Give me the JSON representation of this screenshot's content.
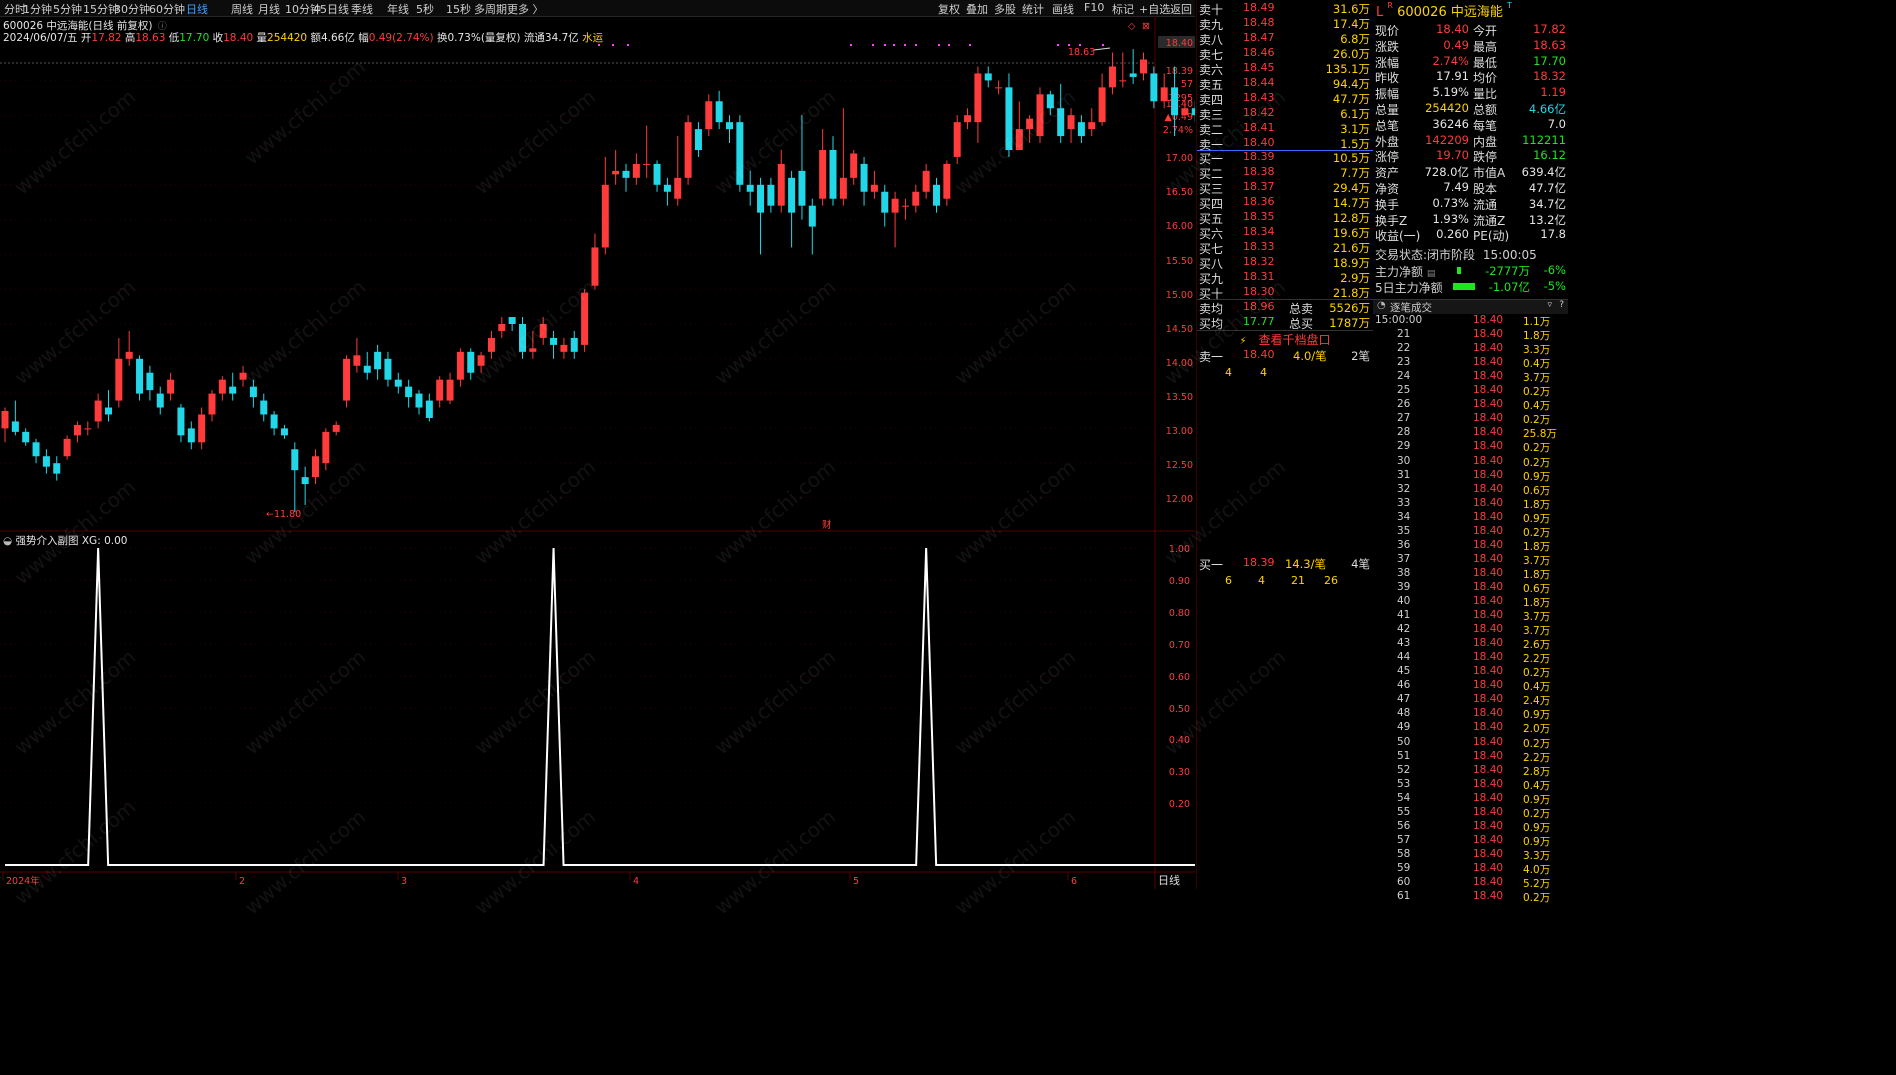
{
  "period_tabs": [
    "分时",
    "1分钟",
    "5分钟",
    "15分钟",
    "30分钟",
    "60分钟",
    "日线",
    "周线",
    "月线",
    "10分钟",
    "45日线",
    "季线",
    "年线",
    "5秒",
    "15秒",
    "多周期",
    "更多 〉"
  ],
  "active_tab": "日线",
  "right_tools": [
    "复权",
    "叠加",
    "多股",
    "统计",
    "画线",
    "F10",
    "标记",
    "+自选",
    "返回"
  ],
  "chart_title": "600026 中远海能(日线 前复权)",
  "ohlc": {
    "date": "2024/06/07/五",
    "open_lbl": "开",
    "open": "17.82",
    "high_lbl": "高",
    "high": "18.63",
    "low_lbl": "低",
    "low": "17.70",
    "close_lbl": "收",
    "close": "18.40",
    "vol_lbl": "量",
    "vol": "254420",
    "amt_lbl": "额",
    "amt": "4.66亿",
    "chg_lbl": "幅",
    "chg": "0.49(2.74%)",
    "turn": "换0.73%(量复权)",
    "float": "流通34.7亿",
    "tag": "水运"
  },
  "price_axis": [
    "18.40",
    "18.39",
    "57",
    "2295",
    "18.40",
    "▲0.49",
    "2.74%",
    "17.00",
    "16.50",
    "16.00",
    "15.50",
    "15.00",
    "14.50",
    "14.00",
    "13.50",
    "13.00",
    "12.50",
    "12.00"
  ],
  "hi_label": "18.63",
  "lo_label": "←11.80",
  "cai": "财",
  "sub_title": "强势介入副图",
  "sub_val": "XG: 0.00",
  "sub_axis": [
    "1.00",
    "0.90",
    "0.80",
    "0.70",
    "0.60",
    "0.50",
    "0.40",
    "0.30",
    "0.20"
  ],
  "date_axis": [
    "2024年",
    "2",
    "3",
    "4",
    "5",
    "6"
  ],
  "period_label": "日线",
  "candles": [
    [
      13.0,
      13.25,
      12.8,
      13.3
    ],
    [
      13.1,
      12.95,
      12.9,
      13.4
    ],
    [
      12.95,
      12.8,
      12.75,
      13.0
    ],
    [
      12.8,
      12.6,
      12.5,
      12.85
    ],
    [
      12.6,
      12.45,
      12.35,
      12.7
    ],
    [
      12.5,
      12.35,
      12.25,
      12.6
    ],
    [
      12.6,
      12.85,
      12.55,
      12.9
    ],
    [
      12.9,
      13.05,
      12.8,
      13.1
    ],
    [
      13.0,
      13.0,
      12.9,
      13.1
    ],
    [
      13.1,
      13.4,
      13.0,
      13.5
    ],
    [
      13.3,
      13.2,
      13.1,
      13.55
    ],
    [
      13.4,
      14.0,
      13.3,
      14.3
    ],
    [
      14.0,
      14.1,
      13.9,
      14.4
    ],
    [
      14.0,
      13.5,
      13.4,
      14.05
    ],
    [
      13.8,
      13.55,
      13.4,
      13.9
    ],
    [
      13.5,
      13.3,
      13.2,
      13.6
    ],
    [
      13.5,
      13.7,
      13.4,
      13.8
    ],
    [
      13.3,
      12.9,
      12.8,
      13.35
    ],
    [
      13.0,
      12.8,
      12.7,
      13.1
    ],
    [
      12.8,
      13.2,
      12.7,
      13.3
    ],
    [
      13.2,
      13.5,
      13.1,
      13.55
    ],
    [
      13.5,
      13.7,
      13.4,
      13.75
    ],
    [
      13.6,
      13.5,
      13.4,
      13.8
    ],
    [
      13.7,
      13.8,
      13.6,
      13.9
    ],
    [
      13.6,
      13.45,
      13.3,
      13.7
    ],
    [
      13.4,
      13.2,
      13.1,
      13.5
    ],
    [
      13.2,
      13.0,
      12.9,
      13.25
    ],
    [
      13.0,
      12.9,
      12.85,
      13.05
    ],
    [
      12.7,
      12.4,
      11.8,
      12.8
    ],
    [
      12.3,
      12.2,
      11.9,
      12.45
    ],
    [
      12.3,
      12.6,
      12.2,
      12.7
    ],
    [
      12.5,
      12.95,
      12.4,
      13.0
    ],
    [
      12.95,
      13.05,
      12.9,
      13.1
    ],
    [
      13.4,
      14.0,
      13.3,
      14.05
    ],
    [
      13.9,
      14.05,
      13.8,
      14.3
    ],
    [
      13.9,
      13.8,
      13.7,
      14.1
    ],
    [
      14.1,
      13.85,
      13.7,
      14.2
    ],
    [
      14.0,
      13.7,
      13.6,
      14.1
    ],
    [
      13.7,
      13.6,
      13.5,
      13.8
    ],
    [
      13.6,
      13.45,
      13.3,
      13.7
    ],
    [
      13.5,
      13.3,
      13.2,
      13.55
    ],
    [
      13.4,
      13.15,
      13.1,
      13.5
    ],
    [
      13.4,
      13.7,
      13.3,
      13.75
    ],
    [
      13.4,
      13.7,
      13.35,
      13.8
    ],
    [
      13.7,
      14.1,
      13.6,
      14.15
    ],
    [
      14.1,
      13.8,
      13.7,
      14.15
    ],
    [
      13.9,
      14.05,
      13.8,
      14.1
    ],
    [
      14.1,
      14.3,
      14.0,
      14.4
    ],
    [
      14.4,
      14.5,
      14.3,
      14.6
    ],
    [
      14.6,
      14.5,
      14.4,
      14.6
    ],
    [
      14.5,
      14.1,
      14.0,
      14.6
    ],
    [
      14.1,
      14.15,
      14.0,
      14.4
    ],
    [
      14.3,
      14.5,
      14.2,
      14.6
    ],
    [
      14.3,
      14.2,
      14.0,
      14.4
    ],
    [
      14.1,
      14.2,
      14.0,
      14.3
    ],
    [
      14.3,
      14.1,
      14.0,
      14.4
    ],
    [
      14.2,
      14.95,
      14.1,
      15.0
    ],
    [
      15.05,
      15.6,
      15.0,
      15.8
    ],
    [
      15.6,
      16.5,
      15.5,
      16.9
    ],
    [
      16.65,
      16.7,
      16.5,
      17.0
    ],
    [
      16.7,
      16.6,
      16.4,
      16.8
    ],
    [
      16.6,
      16.8,
      16.5,
      16.95
    ],
    [
      16.8,
      16.8,
      16.6,
      17.35
    ],
    [
      16.8,
      16.5,
      16.4,
      16.85
    ],
    [
      16.5,
      16.4,
      16.2,
      16.6
    ],
    [
      16.3,
      16.6,
      16.2,
      17.2
    ],
    [
      16.6,
      17.4,
      16.5,
      17.5
    ],
    [
      17.3,
      17.0,
      16.9,
      17.4
    ],
    [
      17.3,
      17.7,
      17.2,
      17.8
    ],
    [
      17.7,
      17.4,
      17.3,
      17.85
    ],
    [
      17.4,
      17.3,
      17.1,
      17.5
    ],
    [
      17.4,
      16.5,
      16.4,
      17.5
    ],
    [
      16.5,
      16.4,
      16.2,
      16.7
    ],
    [
      16.5,
      16.1,
      15.5,
      16.6
    ],
    [
      16.5,
      16.2,
      16.1,
      16.6
    ],
    [
      16.2,
      16.8,
      16.1,
      17.0
    ],
    [
      16.6,
      16.1,
      15.6,
      16.7
    ],
    [
      16.7,
      16.2,
      16.0,
      17.5
    ],
    [
      16.2,
      15.9,
      15.5,
      16.3
    ],
    [
      16.3,
      17.0,
      16.2,
      17.3
    ],
    [
      17.0,
      16.3,
      16.2,
      17.2
    ],
    [
      16.3,
      16.6,
      16.2,
      17.6
    ],
    [
      16.6,
      16.95,
      16.5,
      17.0
    ],
    [
      16.8,
      16.4,
      16.2,
      16.9
    ],
    [
      16.4,
      16.5,
      16.3,
      16.7
    ],
    [
      16.4,
      16.1,
      15.9,
      16.5
    ],
    [
      16.1,
      16.3,
      15.6,
      16.4
    ],
    [
      16.2,
      16.2,
      16.0,
      16.3
    ],
    [
      16.2,
      16.4,
      16.1,
      16.5
    ],
    [
      16.4,
      16.7,
      16.3,
      16.8
    ],
    [
      16.5,
      16.2,
      16.1,
      16.6
    ],
    [
      16.3,
      16.8,
      16.2,
      16.85
    ],
    [
      16.9,
      17.4,
      16.8,
      17.5
    ],
    [
      17.4,
      17.5,
      17.3,
      17.6
    ],
    [
      17.4,
      18.1,
      17.1,
      18.2
    ],
    [
      18.1,
      18.0,
      17.9,
      18.2
    ],
    [
      17.9,
      17.9,
      17.8,
      18.0
    ],
    [
      17.9,
      17.0,
      16.9,
      18.1
    ],
    [
      17.0,
      17.3,
      17.0,
      17.7
    ],
    [
      17.3,
      17.45,
      17.1,
      17.5
    ],
    [
      17.2,
      17.8,
      17.1,
      17.9
    ],
    [
      17.8,
      17.6,
      17.5,
      17.85
    ],
    [
      17.6,
      17.2,
      17.1,
      17.95
    ],
    [
      17.3,
      17.5,
      17.1,
      17.6
    ],
    [
      17.4,
      17.2,
      17.1,
      17.5
    ],
    [
      17.3,
      17.4,
      17.2,
      17.6
    ],
    [
      17.4,
      17.9,
      17.35,
      18.1
    ],
    [
      17.9,
      18.2,
      17.8,
      18.4
    ],
    [
      18.0,
      18.0,
      17.9,
      18.4
    ],
    [
      18.1,
      18.05,
      17.95,
      18.45
    ],
    [
      18.1,
      18.3,
      18.0,
      18.4
    ],
    [
      18.1,
      17.7,
      17.6,
      18.2
    ],
    [
      17.7,
      17.9,
      17.6,
      18.1
    ],
    [
      17.9,
      17.5,
      17.2,
      18.2
    ],
    [
      17.5,
      17.6,
      17.5,
      17.7
    ],
    [
      17.6,
      17.5,
      17.4,
      17.7
    ],
    [
      17.6,
      17.6,
      17.5,
      17.65
    ],
    [
      17.82,
      18.4,
      17.7,
      18.63
    ]
  ],
  "signal_peaks": [
    9,
    53,
    89
  ],
  "order_book": {
    "asks": [
      [
        "卖十",
        "18.49",
        "31.6万"
      ],
      [
        "卖九",
        "18.48",
        "17.4万"
      ],
      [
        "卖八",
        "18.47",
        "6.8万"
      ],
      [
        "卖七",
        "18.46",
        "26.0万"
      ],
      [
        "卖六",
        "18.45",
        "135.1万"
      ],
      [
        "卖五",
        "18.44",
        "94.4万"
      ],
      [
        "卖四",
        "18.43",
        "47.7万"
      ],
      [
        "卖三",
        "18.42",
        "6.1万"
      ],
      [
        "卖二",
        "18.41",
        "3.1万"
      ],
      [
        "卖一",
        "18.40",
        "1.5万"
      ]
    ],
    "bids": [
      [
        "买一",
        "18.39",
        "10.5万"
      ],
      [
        "买二",
        "18.38",
        "7.7万"
      ],
      [
        "买三",
        "18.37",
        "29.4万"
      ],
      [
        "买四",
        "18.36",
        "14.7万"
      ],
      [
        "买五",
        "18.35",
        "12.8万"
      ],
      [
        "买六",
        "18.34",
        "19.6万"
      ],
      [
        "买七",
        "18.33",
        "21.6万"
      ],
      [
        "买八",
        "18.32",
        "18.9万"
      ],
      [
        "买九",
        "18.31",
        "2.9万"
      ],
      [
        "买十",
        "18.30",
        "21.8万"
      ]
    ],
    "sell_avg_lbl": "卖均",
    "sell_avg": "18.96",
    "total_sell_lbl": "总卖",
    "total_sell": "5526万",
    "buy_avg_lbl": "买均",
    "buy_avg": "17.77",
    "total_buy_lbl": "总买",
    "total_buy": "1787万",
    "depth_link": "查看千档盘口",
    "ask1_lbl": "卖一",
    "ask1_px": "18.40",
    "ask1_per": "4.0/笔",
    "ask1_cnt": "2笔",
    "ask1_q": [
      "4",
      "4"
    ],
    "bid1_lbl": "买一",
    "bid1_px": "18.39",
    "bid1_per": "14.3/笔",
    "bid1_cnt": "4笔",
    "bid1_q": [
      "6",
      "4",
      "21",
      "26"
    ]
  },
  "stock_header": {
    "prefix": "L",
    "code": "600026",
    "name": "中远海能"
  },
  "stats": [
    [
      "现价",
      "18.40",
      "今开",
      "17.82"
    ],
    [
      "涨跌",
      "0.49",
      "最高",
      "18.63"
    ],
    [
      "涨幅",
      "2.74%",
      "最低",
      "17.70"
    ],
    [
      "昨收",
      "17.91",
      "均价",
      "18.32"
    ],
    [
      "振幅",
      "5.19%",
      "量比",
      "1.19"
    ],
    [
      "总量",
      "254420",
      "总额",
      "4.66亿"
    ],
    [
      "总笔",
      "36246",
      "每笔",
      "7.0"
    ],
    [
      "外盘",
      "142209",
      "内盘",
      "112211"
    ],
    [
      "涨停",
      "19.70",
      "跌停",
      "16.12"
    ],
    [
      "资产",
      "728.0亿",
      "市值A",
      "639.4亿"
    ],
    [
      "净资",
      "7.49",
      "股本",
      "47.7亿"
    ],
    [
      "换手",
      "0.73%",
      "流通",
      "34.7亿"
    ],
    [
      "换手Z",
      "1.93%",
      "流通Z",
      "13.2亿"
    ],
    [
      "收益(一)",
      "0.260",
      "PE(动)",
      "17.8"
    ]
  ],
  "trade_state_lbl": "交易状态:",
  "trade_state": "闭市阶段",
  "trade_time": "15:00:05",
  "main_flow": {
    "lbl": "主力净额",
    "val": "-2777万",
    "pct": "-6%"
  },
  "main_flow5": {
    "lbl": "5日主力净额",
    "val": "-1.07亿",
    "pct": "-5%"
  },
  "ticks_title": "逐笔成交",
  "ticks": [
    [
      "15:00:00",
      "18.40",
      "1.1万"
    ],
    [
      "21",
      "18.40",
      "1.8万"
    ],
    [
      "22",
      "18.40",
      "3.3万"
    ],
    [
      "23",
      "18.40",
      "0.4万"
    ],
    [
      "24",
      "18.40",
      "3.7万"
    ],
    [
      "25",
      "18.40",
      "0.2万"
    ],
    [
      "26",
      "18.40",
      "0.4万"
    ],
    [
      "27",
      "18.40",
      "0.2万"
    ],
    [
      "28",
      "18.40",
      "25.8万"
    ],
    [
      "29",
      "18.40",
      "0.2万"
    ],
    [
      "30",
      "18.40",
      "0.2万"
    ],
    [
      "31",
      "18.40",
      "0.9万"
    ],
    [
      "32",
      "18.40",
      "0.6万"
    ],
    [
      "33",
      "18.40",
      "1.8万"
    ],
    [
      "34",
      "18.40",
      "0.9万"
    ],
    [
      "35",
      "18.40",
      "0.2万"
    ],
    [
      "36",
      "18.40",
      "1.8万"
    ],
    [
      "37",
      "18.40",
      "3.7万"
    ],
    [
      "38",
      "18.40",
      "1.8万"
    ],
    [
      "39",
      "18.40",
      "0.6万"
    ],
    [
      "40",
      "18.40",
      "1.8万"
    ],
    [
      "41",
      "18.40",
      "3.7万"
    ],
    [
      "42",
      "18.40",
      "3.7万"
    ],
    [
      "43",
      "18.40",
      "2.6万"
    ],
    [
      "44",
      "18.40",
      "2.2万"
    ],
    [
      "45",
      "18.40",
      "0.2万"
    ],
    [
      "46",
      "18.40",
      "0.4万"
    ],
    [
      "47",
      "18.40",
      "2.4万"
    ],
    [
      "48",
      "18.40",
      "0.9万"
    ],
    [
      "49",
      "18.40",
      "2.0万"
    ],
    [
      "50",
      "18.40",
      "0.2万"
    ],
    [
      "51",
      "18.40",
      "2.2万"
    ],
    [
      "52",
      "18.40",
      "2.8万"
    ],
    [
      "53",
      "18.40",
      "0.4万"
    ],
    [
      "54",
      "18.40",
      "0.9万"
    ],
    [
      "55",
      "18.40",
      "0.2万"
    ],
    [
      "56",
      "18.40",
      "0.9万"
    ],
    [
      "57",
      "18.40",
      "0.9万"
    ],
    [
      "58",
      "18.40",
      "3.3万"
    ],
    [
      "59",
      "18.40",
      "4.0万"
    ],
    [
      "60",
      "18.40",
      "5.2万"
    ],
    [
      "61",
      "18.40",
      "0.2万"
    ]
  ],
  "watermark": "www.cfchi.com",
  "colors": {
    "up": "#ff3b3b",
    "down": "#22d8e8",
    "bg": "#000000",
    "grid": "#3a0000"
  }
}
